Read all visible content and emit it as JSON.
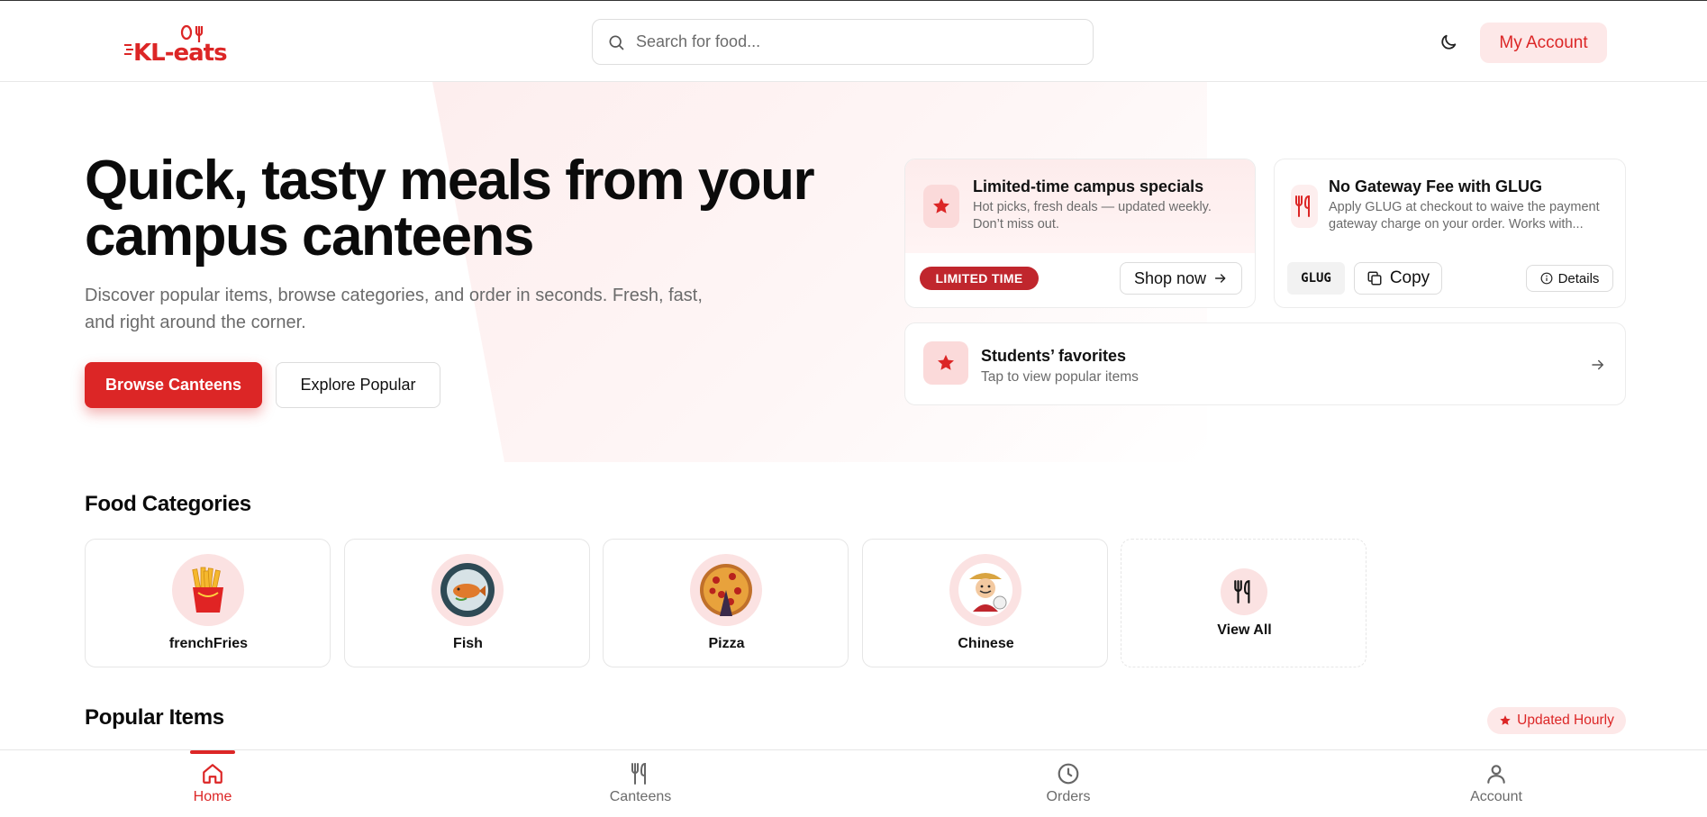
{
  "brand": {
    "logo_text": "KL-eats",
    "accent_color": "#dc2626"
  },
  "header": {
    "search_placeholder": "Search for food...",
    "theme_icon": "moon-icon",
    "account_label": "My Account"
  },
  "hero": {
    "title": "Quick, tasty meals from your campus canteens",
    "subtitle": "Discover popular items, browse categories, and order in seconds. Fresh, fast, and right around the corner.",
    "primary_button": "Browse Canteens",
    "secondary_button": "Explore Popular"
  },
  "promos": {
    "specials": {
      "title": "Limited-time campus specials",
      "description": "Hot picks, fresh deals — updated weekly. Don’t miss out.",
      "badge": "LIMITED TIME",
      "button": "Shop now",
      "icon": "star-icon"
    },
    "glug": {
      "title": "No Gateway Fee with GLUG",
      "description": "Apply GLUG at checkout to waive the payment gateway charge on your order. Works with...",
      "code": "GLUG",
      "copy_label": "Copy",
      "details_label": "Details",
      "icon": "utensils-icon"
    },
    "favorites": {
      "title": "Students’ favorites",
      "subtitle": "Tap to view popular items",
      "icon": "star-icon"
    }
  },
  "categories": {
    "title": "Food Categories",
    "items": [
      {
        "label": "frenchFries"
      },
      {
        "label": "Fish"
      },
      {
        "label": "Pizza"
      },
      {
        "label": "Chinese"
      }
    ],
    "view_all_label": "View All"
  },
  "popular": {
    "title": "Popular Items",
    "badge": "Updated Hourly"
  },
  "bottom_nav": {
    "items": [
      {
        "label": "Home",
        "icon": "home-icon",
        "active": true
      },
      {
        "label": "Canteens",
        "icon": "utensils-icon",
        "active": false
      },
      {
        "label": "Orders",
        "icon": "clock-icon",
        "active": false
      },
      {
        "label": "Account",
        "icon": "user-icon",
        "active": false
      }
    ]
  }
}
